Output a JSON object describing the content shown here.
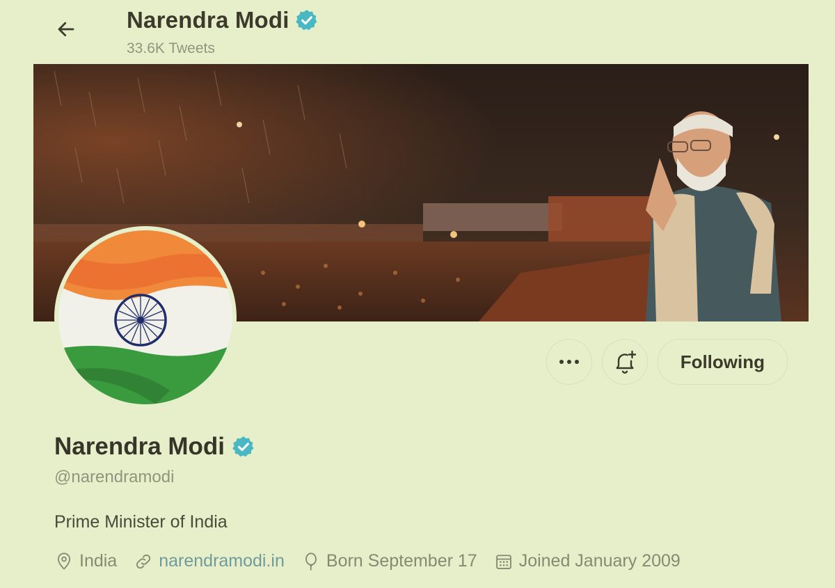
{
  "header": {
    "title": "Narendra Modi",
    "tweet_count": "33.6K Tweets",
    "back_icon": "arrow-left-icon"
  },
  "actions": {
    "more_icon": "more-horizontal-icon",
    "notify_icon": "bell-plus-icon",
    "following_label": "Following"
  },
  "profile": {
    "name": "Narendra Modi",
    "handle": "@narendramodi",
    "bio": "Prime Minister of India",
    "verified": true
  },
  "meta": {
    "location": "India",
    "website": "narendramodi.in",
    "birthday": "Born September 17",
    "joined": "Joined January 2009"
  },
  "colors": {
    "background": "#e7efca",
    "verified": "#49b8c2",
    "link": "#6f9c9a",
    "muted": "#8f957e"
  }
}
